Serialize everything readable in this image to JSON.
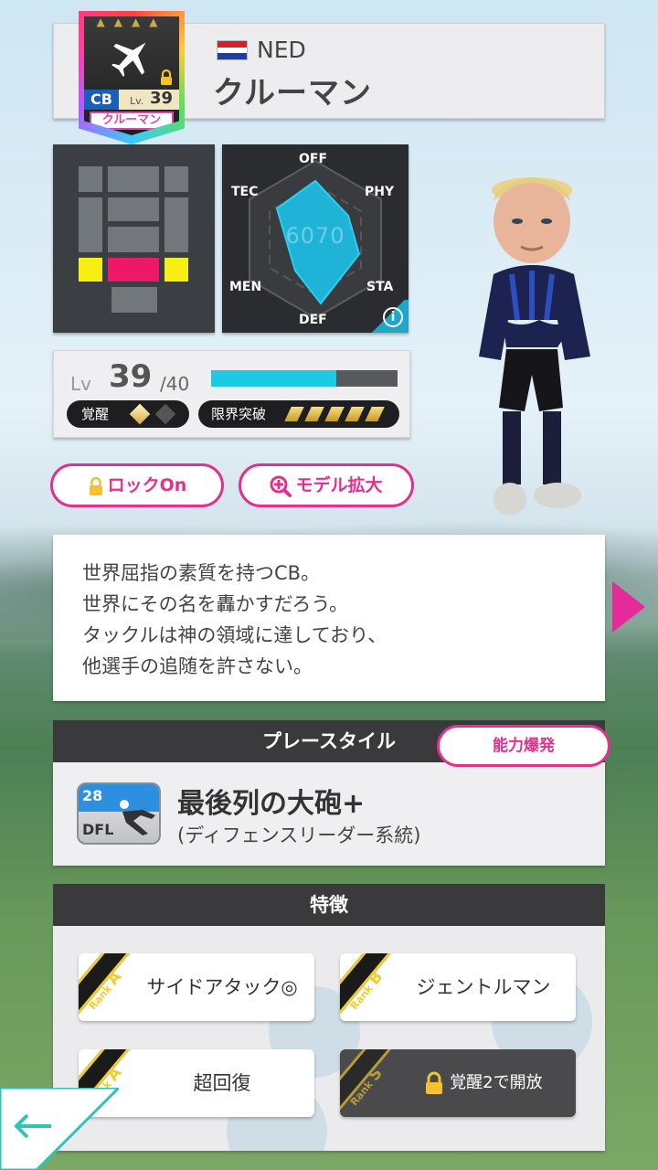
{
  "card": {
    "position": "CB",
    "level_label": "Lv.",
    "level": "39",
    "name": "クルーマン",
    "icon": "airplane-icon"
  },
  "player": {
    "nation": "NED",
    "name": "クルーマン"
  },
  "radar": {
    "labels": {
      "off": "OFF",
      "phy": "PHY",
      "sta": "STA",
      "def": "DEF",
      "men": "MEN",
      "tec": "TEC"
    },
    "total": "6070",
    "info_icon": "info-icon"
  },
  "level": {
    "label": "Lv",
    "value": "39",
    "max": "/40",
    "exp_fraction": 0.67,
    "awakening_label": "覚醒",
    "limit_break_label": "限界突破"
  },
  "buttons": {
    "lock": "ロックOn",
    "model_zoom": "モデル拡大"
  },
  "description": {
    "lines": [
      "世界屈指の素質を持つCB。",
      "世界にその名を轟かすだろう。",
      "タックルは神の領域に達しており、",
      "他選手の追随を許さない。"
    ]
  },
  "play_style": {
    "header": "プレースタイル",
    "burst_button": "能力爆発",
    "icon_number": "28",
    "icon_code": "DFL",
    "name": "最後列の大砲+",
    "subtitle": "(ディフェンスリーダー系統)"
  },
  "traits": {
    "header": "特徴",
    "items": [
      {
        "rank_word": "Rank",
        "rank": "A",
        "label": "サイドアタック◎",
        "locked": false
      },
      {
        "rank_word": "Rank",
        "rank": "B",
        "label": "ジェントルマン",
        "locked": false
      },
      {
        "rank_word": "Rank",
        "rank": "A",
        "label": "超回復",
        "locked": false
      },
      {
        "rank_word": "Rank",
        "rank": "S",
        "label": "覚醒2で開放",
        "locked": true
      }
    ]
  },
  "colors": {
    "accent_pink": "#e2308d",
    "exp_bar": "#1ec9e6",
    "radar_fill": "#1fb3d8"
  }
}
